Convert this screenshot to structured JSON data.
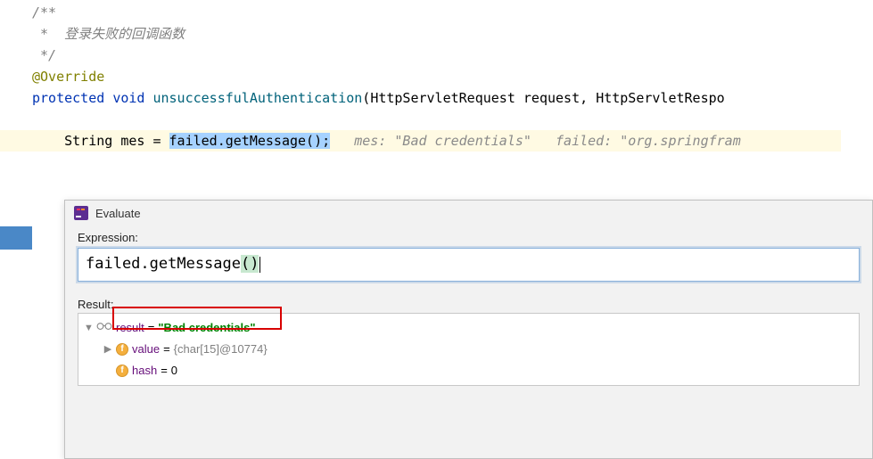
{
  "code": {
    "comment_open": "/**",
    "comment_line": " *  登录失败的回调函数",
    "comment_close": " */",
    "annotation": "@Override",
    "kw_protected": "protected",
    "kw_void": "void",
    "method_name": "unsuccessfulAuthentication",
    "param_type1": "HttpServletRequest",
    "param_name1": "request",
    "param_type2": "HttpServletRespo",
    "stmt_type": "String",
    "stmt_var": "mes",
    "stmt_eq": " = ",
    "stmt_expr": "failed.getMessage();",
    "hint_mes_label": "mes: ",
    "hint_mes_val": "\"Bad credentials\"",
    "hint_failed_label": "failed: ",
    "hint_failed_val": "\"org.springfram"
  },
  "dialog": {
    "title": "Evaluate",
    "expr_label": "Expression:",
    "expr_value_pre": "failed.getMessage",
    "expr_value_paren": "()",
    "result_label": "Result:",
    "tree": {
      "root_name": "result",
      "root_val": "\"Bad credentials\"",
      "child1_name": "value",
      "child1_val": "{char[15]@10774}",
      "child2_name": "hash",
      "child2_val": "0"
    }
  }
}
